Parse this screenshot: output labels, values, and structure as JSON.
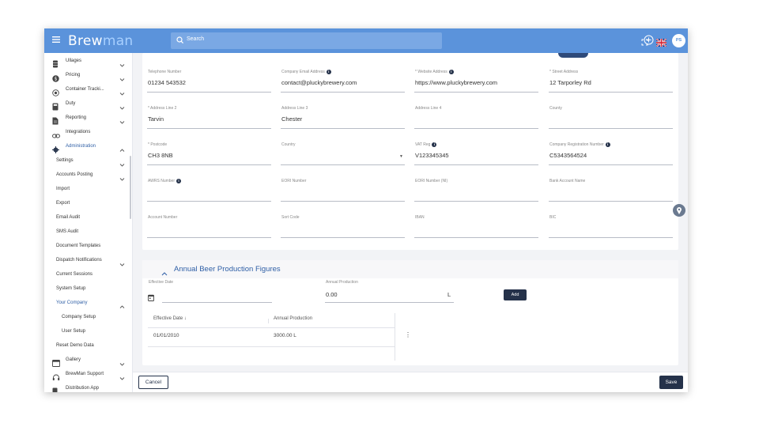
{
  "topbar": {
    "logo_part1": "Brew",
    "logo_part2": "man",
    "search_placeholder": "Search",
    "avatar_initials": "PS",
    "icons": [
      "expand-icon",
      "add-circle-icon",
      "uk-flag-icon"
    ]
  },
  "sidebar": {
    "items": [
      {
        "label": "Ullages",
        "icon": "barrel-icon",
        "chevron": true
      },
      {
        "label": "Pricing",
        "icon": "dollar-icon",
        "chevron": true
      },
      {
        "label": "Container Tracki...",
        "icon": "target-icon",
        "chevron": true
      },
      {
        "label": "Duty",
        "icon": "calculator-icon",
        "chevron": true
      },
      {
        "label": "Reporting",
        "icon": "document-icon",
        "chevron": true
      },
      {
        "label": "Integrations",
        "icon": "link-icon",
        "chevron": false
      },
      {
        "label": "Administration",
        "icon": "gear-icon",
        "chevron": "up"
      },
      {
        "label": "Settings",
        "chevron": true
      },
      {
        "label": "Accounts Posting",
        "chevron": true
      },
      {
        "label": "Import"
      },
      {
        "label": "Export"
      },
      {
        "label": "Email Audit"
      },
      {
        "label": "SMS Audit"
      },
      {
        "label": "Document Templates"
      },
      {
        "label": "Dispatch Notifications",
        "chevron": true
      },
      {
        "label": "Current Sessions"
      },
      {
        "label": "System Setup"
      },
      {
        "label": "Your Company",
        "chevron": "up"
      },
      {
        "label": "Company Setup"
      },
      {
        "label": "User Setup"
      },
      {
        "label": "Reset Demo Data"
      },
      {
        "label": "Gallery",
        "icon": "gallery-icon",
        "chevron": true
      },
      {
        "label": "BrewMan Support",
        "icon": "support-icon",
        "chevron": true
      },
      {
        "label": "Distribution App",
        "icon": "phone-icon"
      }
    ]
  },
  "company": {
    "fields": [
      {
        "label": "Telephone Number",
        "value": "01234 543532",
        "info": false
      },
      {
        "label": "Company Email Address",
        "value": "contact@pluckybrewery.com",
        "info": true
      },
      {
        "label": "* Website Address",
        "value": "https://www.pluckybrewery.com",
        "info": true
      },
      {
        "label": "* Street Address",
        "value": "12 Tarporley Rd",
        "info": false
      },
      {
        "label": "* Address Line 2",
        "value": "Tarvin",
        "info": false
      },
      {
        "label": "Address Line 3",
        "value": "Chester",
        "info": false
      },
      {
        "label": "Address Line 4",
        "value": "",
        "info": false
      },
      {
        "label": "County",
        "value": "",
        "info": false
      },
      {
        "label": "* Postcode",
        "value": "CH3 8NB",
        "info": false
      },
      {
        "label": "Country",
        "value": "",
        "info": false,
        "dropdown": true
      },
      {
        "label": "VAT Reg",
        "value": "V123345345",
        "info": true
      },
      {
        "label": "Company Registration Number",
        "value": "C5343564524",
        "info": true
      },
      {
        "label": "AWRS Number",
        "value": "",
        "info": true
      },
      {
        "label": "EORI Number",
        "value": "",
        "info": false
      },
      {
        "label": "EORI Number (NI)",
        "value": "",
        "info": false
      },
      {
        "label": "Bank Account Name",
        "value": "",
        "info": false
      },
      {
        "label": "Account Number",
        "value": "",
        "info": false
      },
      {
        "label": "Sort Code",
        "value": "",
        "info": false
      },
      {
        "label": "IBAN",
        "value": "",
        "info": false
      },
      {
        "label": "BIC",
        "value": "",
        "info": false
      }
    ]
  },
  "production": {
    "title": "Annual Beer Production Figures",
    "effective_date_label": "Effective Date",
    "effective_date_value": "",
    "annual_production_label": "Annual Production",
    "annual_production_value": "0.00",
    "unit": "L",
    "add_label": "Add",
    "table": {
      "headers": [
        "Effective Date",
        "Annual Production"
      ],
      "sort_indicator": "↓",
      "rows": [
        [
          "01/01/2010",
          "3000.00 L"
        ]
      ]
    }
  },
  "footer": {
    "cancel_label": "Cancel",
    "save_label": "Save"
  },
  "colors": {
    "topbar": "#5b93db",
    "primary_dark": "#25324a",
    "accent_text": "#2f5fa6"
  }
}
